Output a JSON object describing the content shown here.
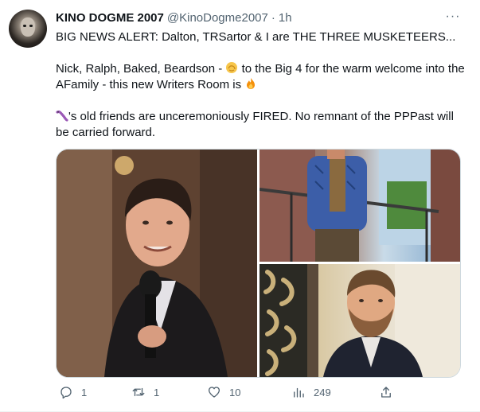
{
  "tweet": {
    "author_name": "KINO DOGME 2007",
    "author_handle": "@KinoDogme2007",
    "separator": "·",
    "time": "1h",
    "more_label": "···",
    "line1": "BIG NEWS ALERT: Dalton, TRSartor & I are THE THREE MUSKETEERS...",
    "line2_pre": "Nick, Ralph, Baked, Beardson -",
    "line2_post": "to the Big 4 for the warm welcome into the AFamily - this new Writers Room is",
    "line3_post": "'s old friends are unceremoniously FIRED. No remnant of the PPPast will be carried forward.",
    "emojis": [
      "fist-bump-icon",
      "fire-icon",
      "worm-icon"
    ]
  },
  "actions": {
    "replies": "1",
    "retweets": "1",
    "likes": "10",
    "views": "249"
  },
  "colors": {
    "text": "#0f1419",
    "secondary": "#536471",
    "border": "#cfd9de"
  }
}
